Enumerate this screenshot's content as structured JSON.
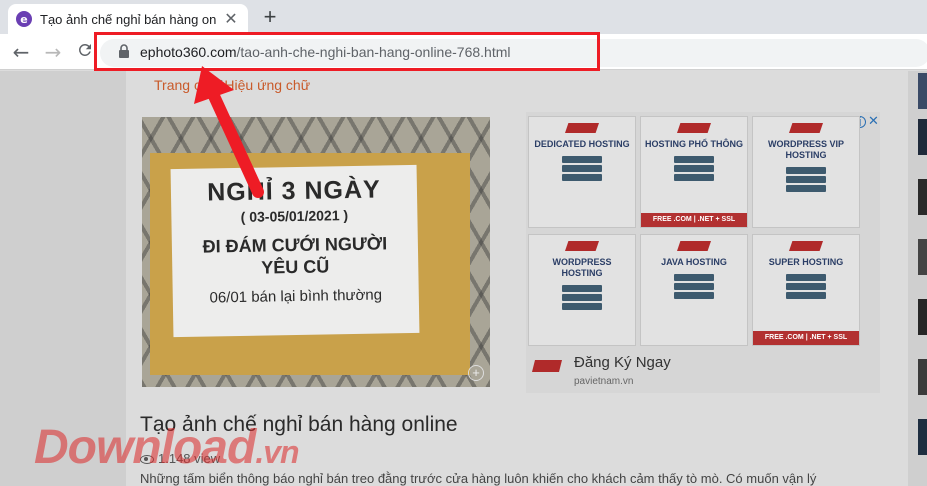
{
  "browser": {
    "tab": {
      "favicon": "e",
      "title": "Tạo ảnh chế nghỉ bán hàng online",
      "close": "✕"
    },
    "new_tab": "+",
    "nav": {
      "back": "←",
      "forward": "→",
      "reload": "C"
    },
    "url": {
      "host": "ephoto360.com",
      "path": "/tao-anh-che-nghi-ban-hang-online-768.html"
    },
    "colors": {
      "highlight": "#ee1c25",
      "arrow": "#ee1c25"
    }
  },
  "page": {
    "breadcrumb": {
      "home": "Trang chủ",
      "separator": "/",
      "category": "Hiệu ứng chữ"
    },
    "image": {
      "line1": "NGHỈ 3 NGÀY",
      "line2": "( 03-05/01/2021 )",
      "line3a": "ĐI ĐÁM CƯỚI NGƯỜI",
      "line3b": "YÊU CŨ",
      "line4": "06/01 bán lại bình thường",
      "zoom_icon": "+"
    },
    "ad": {
      "cards": [
        {
          "title": "DEDICATED HOSTING",
          "footer": ""
        },
        {
          "title": "HOSTING PHỔ THÔNG",
          "footer": "FREE .COM | .NET + SSL"
        },
        {
          "title": "WORDPRESS VIP HOSTING",
          "footer": ""
        },
        {
          "title": "WORDPRESS HOSTING",
          "footer": ""
        },
        {
          "title": "JAVA HOSTING",
          "footer": ""
        },
        {
          "title": "SUPER HOSTING",
          "footer": "FREE .COM | .NET + SSL"
        }
      ],
      "cta_title": "Đăng Ký Ngay",
      "cta_domain": "pavietnam.vn",
      "info_icon": "i",
      "close_icon": "✕"
    },
    "article": {
      "title": "Tạo ảnh chế nghỉ bán hàng online",
      "views": "1.148 view",
      "excerpt": "Những tấm biển thông báo nghỉ bán treo đằng trước cửa hàng luôn khiến cho khách cảm thấy tò mò. Có muốn vận lý"
    }
  },
  "watermark": {
    "main": "Download",
    "suffix": ".vn"
  }
}
